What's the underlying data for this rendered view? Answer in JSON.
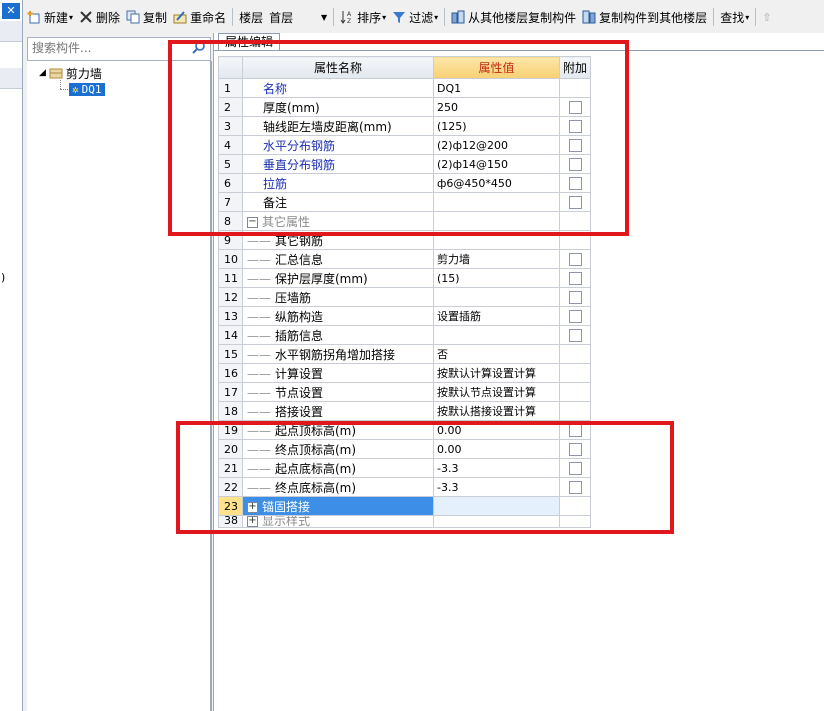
{
  "window": {
    "close_glyph": "✕",
    "side_paren": ")"
  },
  "toolbar": {
    "new_label": "新建",
    "delete_label": "删除",
    "copy_label": "复制",
    "rename_label": "重命名",
    "floor_label": "楼层",
    "floor_value": "首层",
    "sort_label": "排序",
    "filter_label": "过滤",
    "copy_from_label": "从其他楼层复制构件",
    "copy_to_label": "复制构件到其他楼层",
    "find_label": "查找"
  },
  "search": {
    "placeholder": "搜索构件..."
  },
  "tree": {
    "root_label": "剪力墙",
    "child_label": "DQ1"
  },
  "tab": {
    "label": "属性编辑"
  },
  "grid": {
    "header_name": "属性名称",
    "header_value": "属性值",
    "header_add": "附加",
    "rows": [
      {
        "num": "1",
        "name": "名称",
        "value": "DQ1"
      },
      {
        "num": "2",
        "name": "厚度(mm)",
        "value": "250"
      },
      {
        "num": "3",
        "name": "轴线距左墙皮距离(mm)",
        "value": "(125)"
      },
      {
        "num": "4",
        "name": "水平分布钢筋",
        "value": "(2)ф12@200"
      },
      {
        "num": "5",
        "name": "垂直分布钢筋",
        "value": "(2)ф14@150"
      },
      {
        "num": "6",
        "name": "拉筋",
        "value": "ф6@450*450"
      },
      {
        "num": "7",
        "name": "备注",
        "value": ""
      },
      {
        "num": "8",
        "name": "其它属性",
        "value": ""
      },
      {
        "num": "9",
        "name": "其它钢筋",
        "value": ""
      },
      {
        "num": "10",
        "name": "汇总信息",
        "value": "剪力墙"
      },
      {
        "num": "11",
        "name": "保护层厚度(mm)",
        "value": "(15)"
      },
      {
        "num": "12",
        "name": "压墙筋",
        "value": ""
      },
      {
        "num": "13",
        "name": "纵筋构造",
        "value": "设置插筋"
      },
      {
        "num": "14",
        "name": "插筋信息",
        "value": ""
      },
      {
        "num": "15",
        "name": "水平钢筋拐角增加搭接",
        "value": "否"
      },
      {
        "num": "16",
        "name": "计算设置",
        "value": "按默认计算设置计算"
      },
      {
        "num": "17",
        "name": "节点设置",
        "value": "按默认节点设置计算"
      },
      {
        "num": "18",
        "name": "搭接设置",
        "value": "按默认搭接设置计算"
      },
      {
        "num": "19",
        "name": "起点顶标高(m)",
        "value": "0.00"
      },
      {
        "num": "20",
        "name": "终点顶标高(m)",
        "value": "0.00"
      },
      {
        "num": "21",
        "name": "起点底标高(m)",
        "value": "-3.3"
      },
      {
        "num": "22",
        "name": "终点底标高(m)",
        "value": "-3.3"
      },
      {
        "num": "23",
        "name": "锚固搭接",
        "value": ""
      },
      {
        "num": "38",
        "name": "显示样式",
        "value": ""
      }
    ]
  },
  "colors": {
    "highlight_box": "#e0181e",
    "selection": "#3d8ee6",
    "name_blue": "#1b2fb5"
  }
}
